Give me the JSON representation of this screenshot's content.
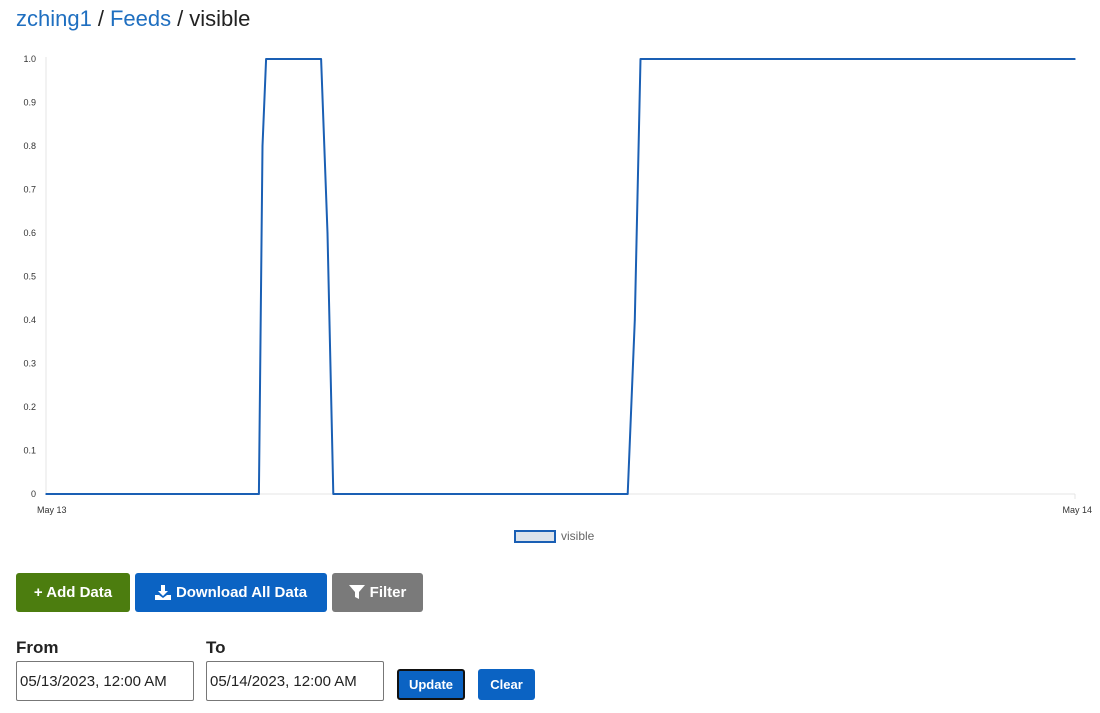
{
  "breadcrumb": {
    "user": "zching1",
    "separator": "/",
    "feeds": "Feeds",
    "current": "visible"
  },
  "chart_data": {
    "type": "line",
    "title": "",
    "xlabel": "",
    "ylabel": "",
    "x_tick_labels": [
      "May 13",
      "May 14"
    ],
    "y_ticks": [
      "0",
      "0.1",
      "0.2",
      "0.3",
      "0.4",
      "0.5",
      "0.6",
      "0.7",
      "0.8",
      "0.9",
      "1.0"
    ],
    "ylim": [
      0,
      1
    ],
    "xlim": [
      "2023-05-13 00:00",
      "2023-05-14 00:00"
    ],
    "grid": false,
    "legend_position": "bottom-center",
    "series": [
      {
        "name": "visible",
        "color": "#1a5fb4",
        "points": [
          [
            "2023-05-13 00:00",
            0
          ],
          [
            "2023-05-13 04:58",
            0
          ],
          [
            "2023-05-13 05:03",
            0.8
          ],
          [
            "2023-05-13 05:08",
            1
          ],
          [
            "2023-05-13 06:25",
            1
          ],
          [
            "2023-05-13 06:34",
            0.6
          ],
          [
            "2023-05-13 06:42",
            0
          ],
          [
            "2023-05-13 13:34",
            0
          ],
          [
            "2023-05-13 13:44",
            0.4
          ],
          [
            "2023-05-13 13:52",
            1
          ],
          [
            "2023-05-14 00:00",
            1
          ]
        ]
      }
    ]
  },
  "actions": {
    "add_data": "+ Add Data",
    "download_all": "Download All Data",
    "filter": "Filter"
  },
  "range": {
    "from_label": "From",
    "to_label": "To",
    "from_value": "05/13/2023, 12:00 AM",
    "to_value": "05/14/2023, 12:00 AM",
    "update": "Update",
    "clear": "Clear"
  },
  "colors": {
    "link": "#1f6fc0",
    "line": "#1a5fb4",
    "green": "#4c7d0f",
    "blue": "#0b63c3",
    "gray": "#7a7a7a"
  }
}
